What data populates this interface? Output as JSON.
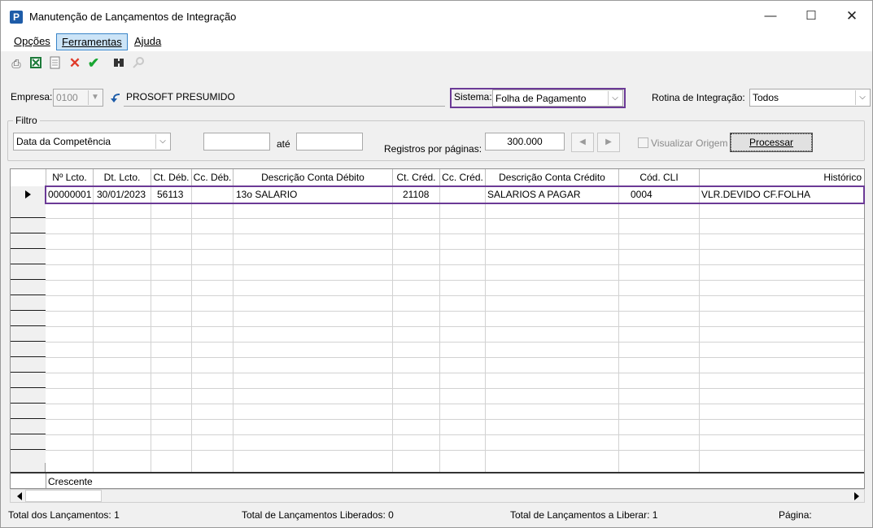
{
  "window": {
    "title": "Manutenção de Lançamentos de Integração",
    "icon_letter": "P"
  },
  "menu": [
    "Opções",
    "Ferramentas",
    "Ajuda"
  ],
  "toolbar": [
    "printer-icon",
    "excel-icon",
    "document-icon",
    "delete-x-icon",
    "confirm-check-icon",
    "binoculars-icon",
    "magnifier-icon"
  ],
  "empresa": {
    "label": "Empresa:",
    "code": "0100",
    "name": "PROSOFT PRESUMIDO"
  },
  "sistema": {
    "label": "Sistema:",
    "value": "Folha de Pagamento"
  },
  "rotina": {
    "label": "Rotina de Integração:",
    "value": "Todos"
  },
  "filtro": {
    "title": "Filtro",
    "tipo": "Data da Competência",
    "de": "",
    "ate_label": "até",
    "ate": "",
    "registros_label": "Registros por páginas:",
    "registros": "300.000",
    "visualizar_origem": "Visualizar Origem",
    "visualizar_checked": false,
    "processar": "Processar"
  },
  "grid": {
    "columns": [
      "Nº Lcto.",
      "Dt. Lcto.",
      "Ct. Déb.",
      "Cc. Déb.",
      "Descrição Conta Débito",
      "Ct. Créd.",
      "Cc. Créd.",
      "Descrição Conta Crédito",
      "Cód. CLI",
      "Histórico"
    ],
    "row": [
      "00000001",
      "30/01/2023",
      "56113",
      "",
      "13o SALARIO",
      "21108",
      "",
      "SALARIOS A PAGAR",
      "0004",
      "VLR.DEVIDO CF.FOLHA"
    ],
    "footer": "Crescente"
  },
  "status": {
    "total": "Total dos Lançamentos: 1",
    "liberados": "Total de Lançamentos Liberados: 0",
    "a_liberar": "Total de Lançamentos a Liberar: 1",
    "pagina": "Página:"
  },
  "colors": {
    "highlight": "#6b3a96",
    "menu_active": "#cce4f7"
  }
}
